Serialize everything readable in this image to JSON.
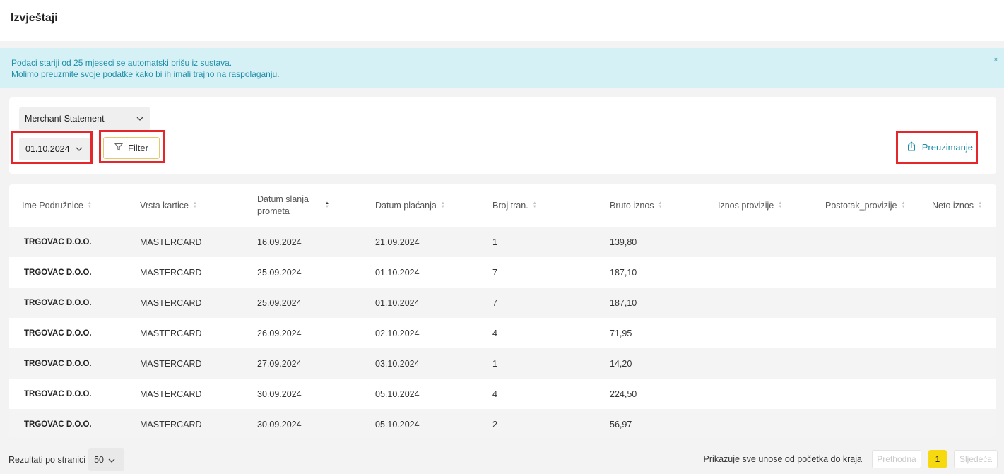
{
  "header": {
    "title": "Izvještaji"
  },
  "alert": {
    "line1": "Podaci stariji od 25 mjeseci se automatski brišu iz sustava.",
    "line2": "Molimo preuzmite svoje podatke kako bi ih imali trajno na raspolaganju.",
    "close": "×"
  },
  "controls": {
    "report_type": "Merchant Statement",
    "date": "01.10.2024",
    "filter_label": "Filter",
    "download_label": "Preuzimanje"
  },
  "table": {
    "columns": [
      "Ime Podružnice",
      "Vrsta kartice",
      "Datum slanja prometa",
      "Datum plaćanja",
      "Broj tran.",
      "Bruto iznos",
      "Iznos provizije",
      "Postotak_provizije",
      "Neto iznos"
    ],
    "rows": [
      [
        "TRGOVAC D.O.O.",
        "MASTERCARD",
        "16.09.2024",
        "21.09.2024",
        "1",
        "139,80",
        "",
        "",
        ""
      ],
      [
        "TRGOVAC D.O.O.",
        "MASTERCARD",
        "25.09.2024",
        "01.10.2024",
        "7",
        "187,10",
        "",
        "",
        ""
      ],
      [
        "TRGOVAC D.O.O.",
        "MASTERCARD",
        "25.09.2024",
        "01.10.2024",
        "7",
        "187,10",
        "",
        "",
        ""
      ],
      [
        "TRGOVAC D.O.O.",
        "MASTERCARD",
        "26.09.2024",
        "02.10.2024",
        "4",
        "71,95",
        "",
        "",
        ""
      ],
      [
        "TRGOVAC D.O.O.",
        "MASTERCARD",
        "27.09.2024",
        "03.10.2024",
        "1",
        "14,20",
        "",
        "",
        ""
      ],
      [
        "TRGOVAC D.O.O.",
        "MASTERCARD",
        "30.09.2024",
        "05.10.2024",
        "4",
        "224,50",
        "",
        "",
        ""
      ],
      [
        "TRGOVAC D.O.O.",
        "MASTERCARD",
        "30.09.2024",
        "05.10.2024",
        "2",
        "56,97",
        "",
        "",
        ""
      ]
    ]
  },
  "footer": {
    "per_page_label": "Rezultati po stranici",
    "per_page_value": "50",
    "info": "Prikazuje sve unose od početka do kraja",
    "prev": "Prethodna",
    "current_page": "1",
    "next": "Sljedeća"
  },
  "colors": {
    "accent": "#1e8ea8",
    "highlight": "#e5262b",
    "page_active": "#f6d90f"
  }
}
